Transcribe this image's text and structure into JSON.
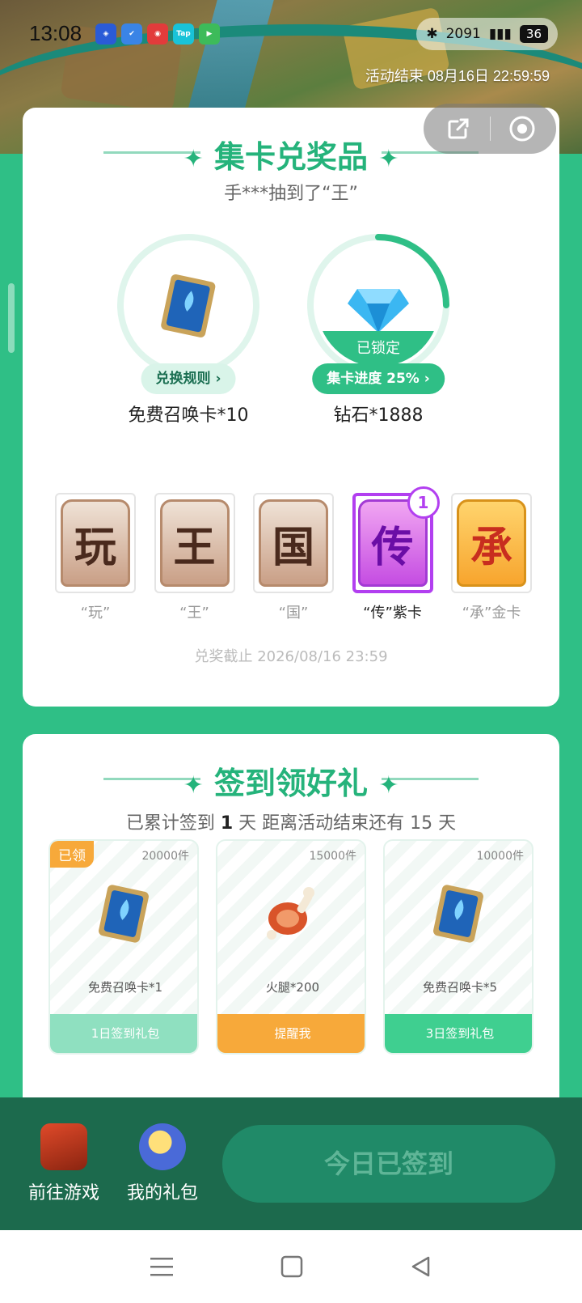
{
  "status_bar": {
    "time": "13:08",
    "right_text": "2091",
    "battery": "36"
  },
  "banner": {
    "end_time": "活动结束 08月16日 22:59:59"
  },
  "capsule": {
    "share_icon": "share-icon",
    "close_icon": "record-icon"
  },
  "collect": {
    "title": "集卡兑奖品",
    "ticker": "手***抽到了“王”",
    "prizes": [
      {
        "name": "免费召唤卡*10",
        "pill": "兑换规则 ›"
      },
      {
        "name": "钻石*1888",
        "pill": "集卡进度 25% ›",
        "locked_label": "已锁定",
        "progress": 0.25
      }
    ],
    "cards": [
      {
        "char": "玩",
        "label": "“玩”"
      },
      {
        "char": "王",
        "label": "“王”"
      },
      {
        "char": "国",
        "label": "“国”"
      },
      {
        "char": "传",
        "label": "“传”紫卡",
        "count": "1"
      },
      {
        "char": "承",
        "label": "“承”金卡"
      }
    ],
    "deadline": "兑奖截止 2026/08/16 23:59"
  },
  "signin": {
    "title": "签到领好礼",
    "summary_prefix": "已累计签到",
    "summary_days": "1",
    "summary_suffix": "天  距离活动结束还有 15 天",
    "gifts": [
      {
        "qty": "20000件",
        "tag": "已领",
        "name": "免费召唤卡*1",
        "button": "1日签到礼包"
      },
      {
        "qty": "15000件",
        "name": "火腿*200",
        "button": "提醒我"
      },
      {
        "qty": "10000件",
        "name": "免费召唤卡*5",
        "button": "3日签到礼包"
      }
    ]
  },
  "bottom": {
    "go_game": "前往游戏",
    "my_gifts": "我的礼包",
    "signed": "今日已签到"
  },
  "colors": {
    "accent": "#2fbf86",
    "dark": "#1c6a4d",
    "orange": "#f7a93a",
    "purple": "#b23ff0"
  }
}
